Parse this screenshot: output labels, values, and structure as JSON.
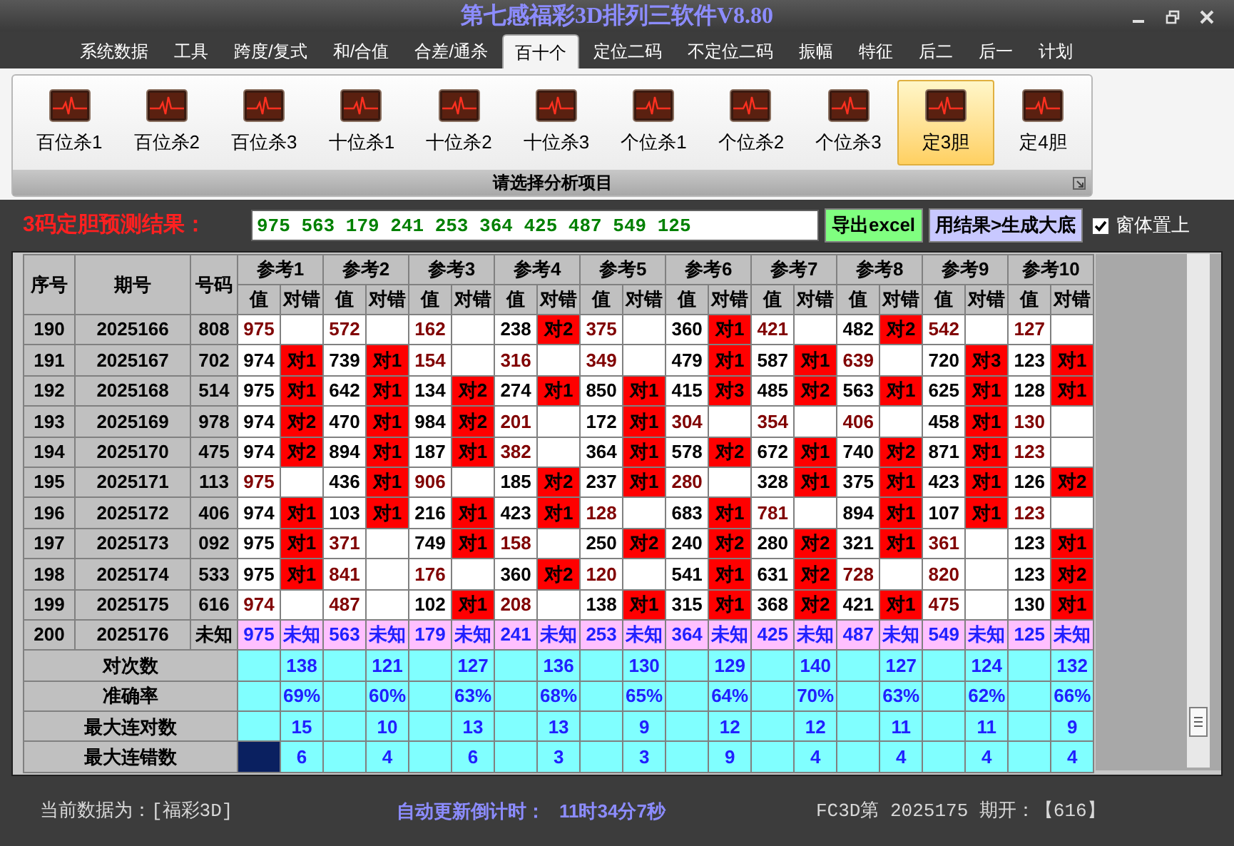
{
  "window": {
    "title": "第七感福彩3D排列三软件V8.80"
  },
  "menu": {
    "tabs": [
      {
        "label": "系统数据",
        "selected": false
      },
      {
        "label": "工具",
        "selected": false
      },
      {
        "label": "跨度/复式",
        "selected": false
      },
      {
        "label": "和/合值",
        "selected": false
      },
      {
        "label": "合差/通杀",
        "selected": false
      },
      {
        "label": "百十个",
        "selected": true
      },
      {
        "label": "定位二码",
        "selected": false
      },
      {
        "label": "不定位二码",
        "selected": false
      },
      {
        "label": "振幅",
        "selected": false
      },
      {
        "label": "特征",
        "selected": false
      },
      {
        "label": "后二",
        "selected": false
      },
      {
        "label": "后一",
        "selected": false
      },
      {
        "label": "计划",
        "selected": false
      }
    ]
  },
  "ribbon": {
    "items": [
      {
        "label": "百位杀1",
        "selected": false
      },
      {
        "label": "百位杀2",
        "selected": false
      },
      {
        "label": "百位杀3",
        "selected": false
      },
      {
        "label": "十位杀1",
        "selected": false
      },
      {
        "label": "十位杀2",
        "selected": false
      },
      {
        "label": "十位杀3",
        "selected": false
      },
      {
        "label": "个位杀1",
        "selected": false
      },
      {
        "label": "个位杀2",
        "selected": false
      },
      {
        "label": "个位杀3",
        "selected": false
      },
      {
        "label": "定3胆",
        "selected": true
      },
      {
        "label": "定4胆",
        "selected": false
      }
    ],
    "footer": "请选择分析项目"
  },
  "prediction": {
    "label": "3码定胆预测结果：",
    "value": "975 563 179 241 253 364 425 487 549 125",
    "buttons": [
      {
        "label": "导出excel",
        "kind": "export"
      },
      {
        "label": "用结果>生成大底",
        "kind": "generate"
      }
    ],
    "pin_checkbox": {
      "label": "窗体置上",
      "checked": true
    }
  },
  "table": {
    "columns": [
      "序号",
      "期号",
      "号码"
    ],
    "groups": [
      {
        "label": "参考1",
        "sub_columns": [
          "值",
          "对错"
        ]
      },
      {
        "label": "参考2",
        "sub_columns": [
          "值",
          "对错"
        ]
      },
      {
        "label": "参考3",
        "sub_columns": [
          "值",
          "对错"
        ]
      },
      {
        "label": "参考4",
        "sub_columns": [
          "值",
          "对错"
        ]
      },
      {
        "label": "参考5",
        "sub_columns": [
          "值",
          "对错"
        ]
      },
      {
        "label": "参考6",
        "sub_columns": [
          "值",
          "对错"
        ]
      },
      {
        "label": "参考7",
        "sub_columns": [
          "值",
          "对错"
        ]
      },
      {
        "label": "参考8",
        "sub_columns": [
          "值",
          "对错"
        ]
      },
      {
        "label": "参考9",
        "sub_columns": [
          "值",
          "对错"
        ]
      },
      {
        "label": "参考10",
        "sub_columns": [
          "值",
          "对错"
        ]
      }
    ],
    "rows": [
      {
        "seq": "190",
        "period": "2025166",
        "number": "808",
        "kind": "history",
        "refs": [
          {
            "value": "975",
            "hit": false
          },
          {
            "value": "572",
            "hit": false
          },
          {
            "value": "162",
            "hit": false
          },
          {
            "value": "238",
            "hit": true,
            "result": "对2"
          },
          {
            "value": "375",
            "hit": false
          },
          {
            "value": "360",
            "hit": true,
            "result": "对1"
          },
          {
            "value": "421",
            "hit": false
          },
          {
            "value": "482",
            "hit": true,
            "result": "对2"
          },
          {
            "value": "542",
            "hit": false
          },
          {
            "value": "127",
            "hit": false
          }
        ]
      },
      {
        "seq": "191",
        "period": "2025167",
        "number": "702",
        "kind": "history",
        "refs": [
          {
            "value": "974",
            "hit": true,
            "result": "对1"
          },
          {
            "value": "739",
            "hit": true,
            "result": "对1"
          },
          {
            "value": "154",
            "hit": false
          },
          {
            "value": "316",
            "hit": false
          },
          {
            "value": "349",
            "hit": false
          },
          {
            "value": "479",
            "hit": true,
            "result": "对1"
          },
          {
            "value": "587",
            "hit": true,
            "result": "对1"
          },
          {
            "value": "639",
            "hit": false
          },
          {
            "value": "720",
            "hit": true,
            "result": "对3"
          },
          {
            "value": "123",
            "hit": true,
            "result": "对1"
          }
        ]
      },
      {
        "seq": "192",
        "period": "2025168",
        "number": "514",
        "kind": "history",
        "refs": [
          {
            "value": "975",
            "hit": true,
            "result": "对1"
          },
          {
            "value": "642",
            "hit": true,
            "result": "对1"
          },
          {
            "value": "134",
            "hit": true,
            "result": "对2"
          },
          {
            "value": "274",
            "hit": true,
            "result": "对1"
          },
          {
            "value": "850",
            "hit": true,
            "result": "对1"
          },
          {
            "value": "415",
            "hit": true,
            "result": "对3"
          },
          {
            "value": "485",
            "hit": true,
            "result": "对2"
          },
          {
            "value": "563",
            "hit": true,
            "result": "对1"
          },
          {
            "value": "625",
            "hit": true,
            "result": "对1"
          },
          {
            "value": "128",
            "hit": true,
            "result": "对1"
          }
        ]
      },
      {
        "seq": "193",
        "period": "2025169",
        "number": "978",
        "kind": "history",
        "refs": [
          {
            "value": "974",
            "hit": true,
            "result": "对2"
          },
          {
            "value": "470",
            "hit": true,
            "result": "对1"
          },
          {
            "value": "984",
            "hit": true,
            "result": "对2"
          },
          {
            "value": "201",
            "hit": false
          },
          {
            "value": "172",
            "hit": true,
            "result": "对1"
          },
          {
            "value": "304",
            "hit": false
          },
          {
            "value": "354",
            "hit": false
          },
          {
            "value": "406",
            "hit": false
          },
          {
            "value": "458",
            "hit": true,
            "result": "对1"
          },
          {
            "value": "130",
            "hit": false
          }
        ]
      },
      {
        "seq": "194",
        "period": "2025170",
        "number": "475",
        "kind": "history",
        "refs": [
          {
            "value": "974",
            "hit": true,
            "result": "对2"
          },
          {
            "value": "894",
            "hit": true,
            "result": "对1"
          },
          {
            "value": "187",
            "hit": true,
            "result": "对1"
          },
          {
            "value": "382",
            "hit": false
          },
          {
            "value": "364",
            "hit": true,
            "result": "对1"
          },
          {
            "value": "578",
            "hit": true,
            "result": "对2"
          },
          {
            "value": "672",
            "hit": true,
            "result": "对1"
          },
          {
            "value": "740",
            "hit": true,
            "result": "对2"
          },
          {
            "value": "871",
            "hit": true,
            "result": "对1"
          },
          {
            "value": "123",
            "hit": false
          }
        ]
      },
      {
        "seq": "195",
        "period": "2025171",
        "number": "113",
        "kind": "history",
        "refs": [
          {
            "value": "975",
            "hit": false
          },
          {
            "value": "436",
            "hit": true,
            "result": "对1"
          },
          {
            "value": "906",
            "hit": false
          },
          {
            "value": "185",
            "hit": true,
            "result": "对2"
          },
          {
            "value": "237",
            "hit": true,
            "result": "对1"
          },
          {
            "value": "280",
            "hit": false
          },
          {
            "value": "328",
            "hit": true,
            "result": "对1"
          },
          {
            "value": "375",
            "hit": true,
            "result": "对1"
          },
          {
            "value": "423",
            "hit": true,
            "result": "对1"
          },
          {
            "value": "126",
            "hit": true,
            "result": "对2"
          }
        ]
      },
      {
        "seq": "196",
        "period": "2025172",
        "number": "406",
        "kind": "history",
        "refs": [
          {
            "value": "974",
            "hit": true,
            "result": "对1"
          },
          {
            "value": "103",
            "hit": true,
            "result": "对1"
          },
          {
            "value": "216",
            "hit": true,
            "result": "对1"
          },
          {
            "value": "423",
            "hit": true,
            "result": "对1"
          },
          {
            "value": "128",
            "hit": false
          },
          {
            "value": "683",
            "hit": true,
            "result": "对1"
          },
          {
            "value": "781",
            "hit": false
          },
          {
            "value": "894",
            "hit": true,
            "result": "对1"
          },
          {
            "value": "107",
            "hit": true,
            "result": "对1"
          },
          {
            "value": "123",
            "hit": false
          }
        ]
      },
      {
        "seq": "197",
        "period": "2025173",
        "number": "092",
        "kind": "history",
        "refs": [
          {
            "value": "975",
            "hit": true,
            "result": "对1"
          },
          {
            "value": "371",
            "hit": false
          },
          {
            "value": "749",
            "hit": true,
            "result": "对1"
          },
          {
            "value": "158",
            "hit": false
          },
          {
            "value": "250",
            "hit": true,
            "result": "对2"
          },
          {
            "value": "240",
            "hit": true,
            "result": "对2"
          },
          {
            "value": "280",
            "hit": true,
            "result": "对2"
          },
          {
            "value": "321",
            "hit": true,
            "result": "对1"
          },
          {
            "value": "361",
            "hit": false
          },
          {
            "value": "123",
            "hit": true,
            "result": "对1"
          }
        ]
      },
      {
        "seq": "198",
        "period": "2025174",
        "number": "533",
        "kind": "history",
        "refs": [
          {
            "value": "975",
            "hit": true,
            "result": "对1"
          },
          {
            "value": "841",
            "hit": false
          },
          {
            "value": "176",
            "hit": false
          },
          {
            "value": "360",
            "hit": true,
            "result": "对2"
          },
          {
            "value": "120",
            "hit": false
          },
          {
            "value": "541",
            "hit": true,
            "result": "对1"
          },
          {
            "value": "631",
            "hit": true,
            "result": "对2"
          },
          {
            "value": "728",
            "hit": false
          },
          {
            "value": "820",
            "hit": false
          },
          {
            "value": "123",
            "hit": true,
            "result": "对2"
          }
        ]
      },
      {
        "seq": "199",
        "period": "2025175",
        "number": "616",
        "kind": "history",
        "refs": [
          {
            "value": "974",
            "hit": false
          },
          {
            "value": "487",
            "hit": false
          },
          {
            "value": "102",
            "hit": true,
            "result": "对1"
          },
          {
            "value": "208",
            "hit": false
          },
          {
            "value": "138",
            "hit": true,
            "result": "对1"
          },
          {
            "value": "315",
            "hit": true,
            "result": "对1"
          },
          {
            "value": "368",
            "hit": true,
            "result": "对2"
          },
          {
            "value": "421",
            "hit": true,
            "result": "对1"
          },
          {
            "value": "475",
            "hit": false
          },
          {
            "value": "130",
            "hit": true,
            "result": "对1"
          }
        ]
      },
      {
        "seq": "200",
        "period": "2025176",
        "number": "未知",
        "kind": "pending",
        "refs": [
          {
            "value": "975",
            "result": "未知"
          },
          {
            "value": "563",
            "result": "未知"
          },
          {
            "value": "179",
            "result": "未知"
          },
          {
            "value": "241",
            "result": "未知"
          },
          {
            "value": "253",
            "result": "未知"
          },
          {
            "value": "364",
            "result": "未知"
          },
          {
            "value": "425",
            "result": "未知"
          },
          {
            "value": "487",
            "result": "未知"
          },
          {
            "value": "549",
            "result": "未知"
          },
          {
            "value": "125",
            "result": "未知"
          }
        ]
      }
    ],
    "summary": [
      {
        "label": "对次数",
        "values": [
          "138",
          "121",
          "127",
          "136",
          "130",
          "129",
          "140",
          "127",
          "124",
          "132"
        ],
        "first_cell_selected": false
      },
      {
        "label": "准确率",
        "values": [
          "69%",
          "60%",
          "63%",
          "68%",
          "65%",
          "64%",
          "70%",
          "63%",
          "62%",
          "66%"
        ],
        "first_cell_selected": false
      },
      {
        "label": "最大连对数",
        "values": [
          "15",
          "10",
          "13",
          "13",
          "9",
          "12",
          "12",
          "11",
          "11",
          "9"
        ],
        "first_cell_selected": false
      },
      {
        "label": "最大连错数",
        "values": [
          "6",
          "4",
          "6",
          "3",
          "3",
          "9",
          "4",
          "4",
          "4",
          "4"
        ],
        "first_cell_selected": true
      }
    ]
  },
  "status_bar": {
    "data_source": "当前数据为：[福彩3D]",
    "countdown_label": "自动更新倒计时：",
    "countdown": "11时34分7秒",
    "latest": "FC3D第 2025175 期开：【616】"
  }
}
